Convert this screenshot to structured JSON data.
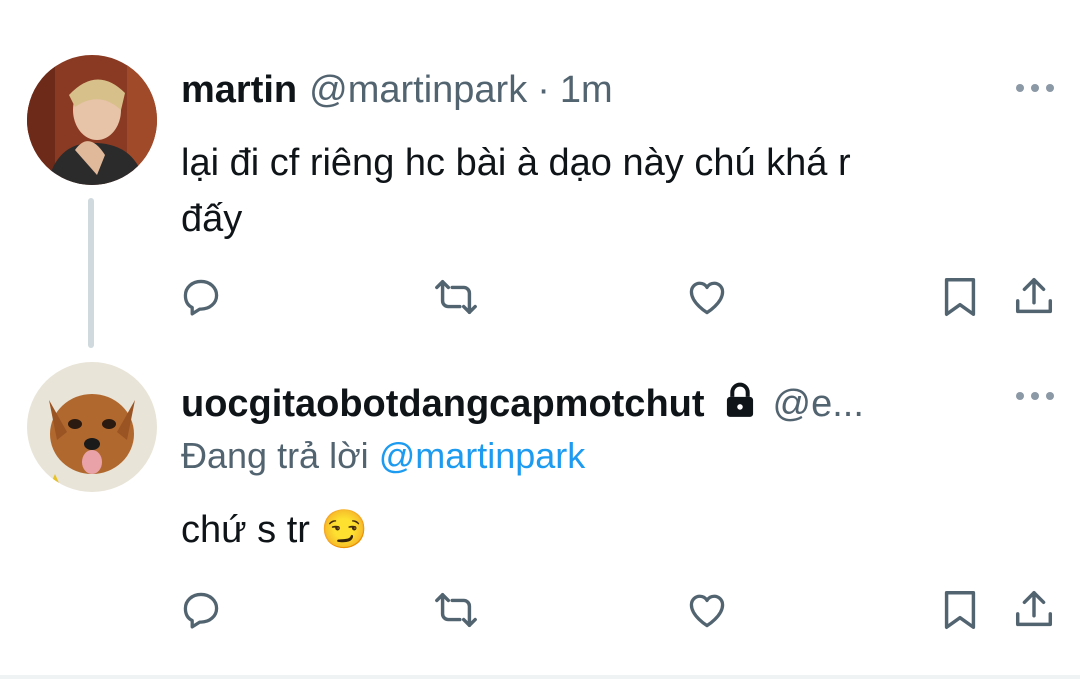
{
  "tweets": [
    {
      "display_name": "martin",
      "handle": "@martinpark",
      "separator": "·",
      "time": "1m",
      "text_line1": "lại đi cf riêng hc bài à dạo này chú khá r",
      "text_line2": "đấy",
      "locked": false
    },
    {
      "display_name": "uocgitaobotdangcapmotchut",
      "handle": "@e...",
      "locked": true,
      "reply_prefix": "Đang trả lời ",
      "reply_to_handle": "@martinpark",
      "text": "chứ s tr 😏"
    }
  ],
  "icons": {
    "avatar": "avatar",
    "more": "more-icon",
    "lock": "lock-icon",
    "reply": "reply-icon",
    "retweet": "retweet-icon",
    "like": "like-icon",
    "bookmark": "bookmark-icon",
    "share": "share-icon"
  },
  "colors": {
    "text_primary": "#0f1419",
    "text_secondary": "#536471",
    "link": "#1d9bf0",
    "thread_line": "#cfd9de"
  }
}
